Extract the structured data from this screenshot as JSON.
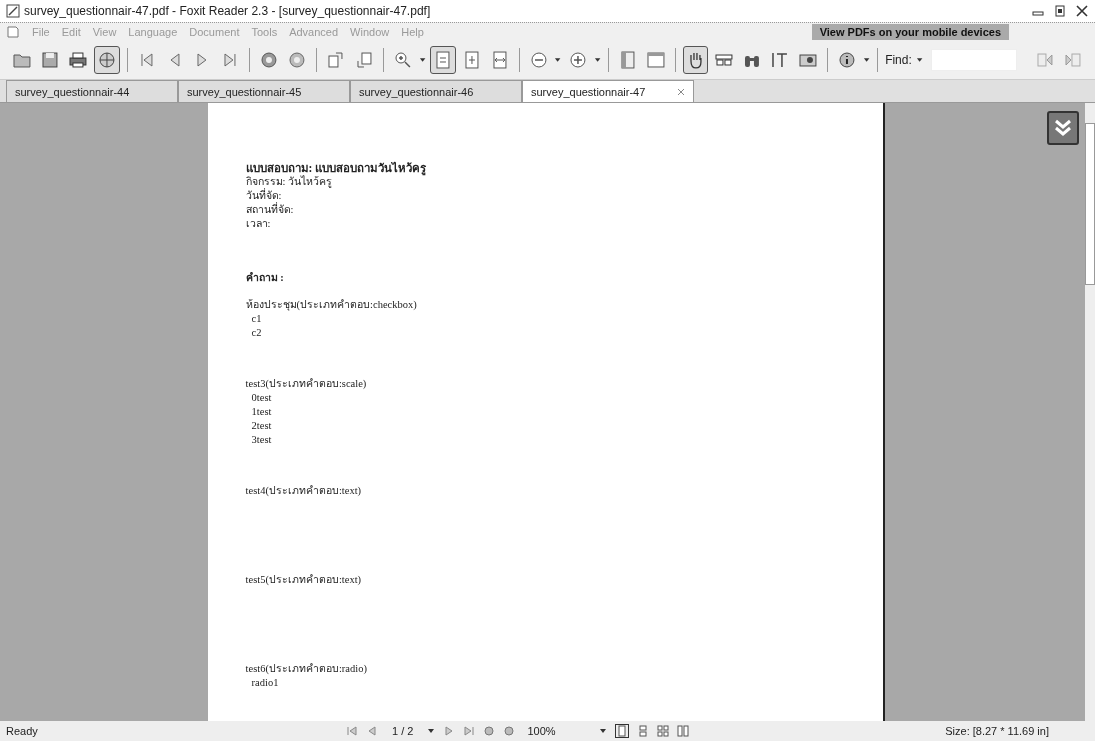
{
  "window": {
    "title": "survey_questionnair-47.pdf - Foxit Reader 2.3 - [survey_questionnair-47.pdf]"
  },
  "menu": [
    "File",
    "Edit",
    "View",
    "Language",
    "Document",
    "Tools",
    "Advanced",
    "Window",
    "Help"
  ],
  "banner": {
    "text": "View PDFs on your mobile devices"
  },
  "find": {
    "label": "Find:"
  },
  "tabs": [
    {
      "label": "survey_questionnair-44",
      "selected": false
    },
    {
      "label": "survey_questionnair-45",
      "selected": false
    },
    {
      "label": "survey_questionnair-46",
      "selected": false
    },
    {
      "label": "survey_questionnair-47",
      "selected": true
    }
  ],
  "document": {
    "title": "แบบสอบถาม: แบบสอบถามวันไหว้ครู",
    "details": [
      "กิจกรรม: วันไหว้ครู",
      "วันที่จัด:",
      "สถานที่จัด:",
      "เวลา:"
    ],
    "questions_heading": "คำถาม :",
    "questions": [
      {
        "kind": "choice",
        "text": "ห้องประชุม(ประเภทคำตอบ:checkbox)",
        "options": [
          "c1",
          "c2"
        ]
      },
      {
        "kind": "choice",
        "text": "test3(ประเภทคำตอบ:scale)",
        "options": [
          "0test",
          "1test",
          "2test",
          "3test"
        ]
      },
      {
        "kind": "text",
        "text": "test4(ประเภทคำตอบ:text)"
      },
      {
        "kind": "text",
        "text": "test5(ประเภทคำตอบ:text)"
      },
      {
        "kind": "choice",
        "text": "test6(ประเภทคำตอบ:radio)",
        "options": [
          "radio1"
        ]
      }
    ]
  },
  "status_bar": {
    "status": "Ready",
    "page": "1 / 2",
    "zoom": "100%",
    "size": "Size: [8.27 * 11.69 in]"
  }
}
